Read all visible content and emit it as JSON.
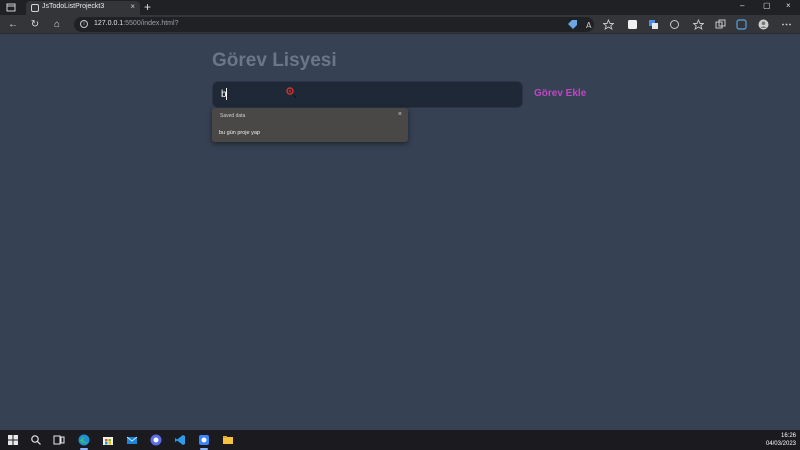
{
  "browser": {
    "tab_title": "JsTodoListProjeckt3",
    "tab_close": "×",
    "new_tab": "+",
    "url_host": "127.0.0.1",
    "url_rest": ":5500/index.html?",
    "window_controls": [
      "–",
      "▢",
      "×"
    ]
  },
  "page": {
    "title": "Görev Lisyesi",
    "input_value": "b",
    "add_button_label": "Görev Ekle",
    "accent_color": "#c046c4"
  },
  "autofill": {
    "header": "Saved data",
    "items": [
      "bu gün proje yap"
    ],
    "close": "×"
  },
  "taskbar": {
    "time": "16:26",
    "date": "04/03/2023",
    "icons": [
      "windows-icon",
      "search-icon",
      "task-view-icon",
      "edge-icon",
      "store-icon",
      "mail-icon",
      "app-icon",
      "vscode-icon",
      "app2-icon",
      "file-explorer-icon"
    ]
  }
}
